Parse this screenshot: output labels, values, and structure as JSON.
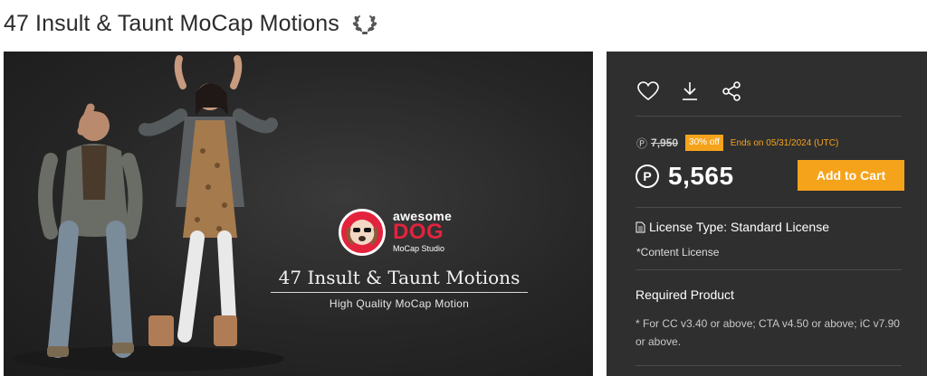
{
  "page": {
    "title": "47 Insult & Taunt MoCap Motions",
    "title_icon": "laurel-icon"
  },
  "hero": {
    "logo_line1": "awesome",
    "logo_line2": "DOG",
    "logo_line3": "MoCap Studio",
    "product_title": "47 Insult & Taunt Motions",
    "subtitle": "High Quality MoCap Motion"
  },
  "panel": {
    "actions": [
      "heart-icon",
      "download-icon",
      "share-icon"
    ],
    "original_price": "7,950",
    "discount_badge": "30% off",
    "sale_ends": "Ends on 05/31/2024 (UTC)",
    "currency_symbol": "P",
    "price": "5,565",
    "add_to_cart": "Add to Cart",
    "license_type": "License Type: Standard License",
    "content_license": "*Content License",
    "required_product_title": "Required Product",
    "required_product_text": "* For CC v3.40 or above; CTA v4.50 or above; iC v7.90 or above."
  },
  "colors": {
    "accent": "#f5a31b",
    "panel_bg": "#2f2f2f",
    "hero_bg": "#262626",
    "logo_red": "#e3233d"
  }
}
